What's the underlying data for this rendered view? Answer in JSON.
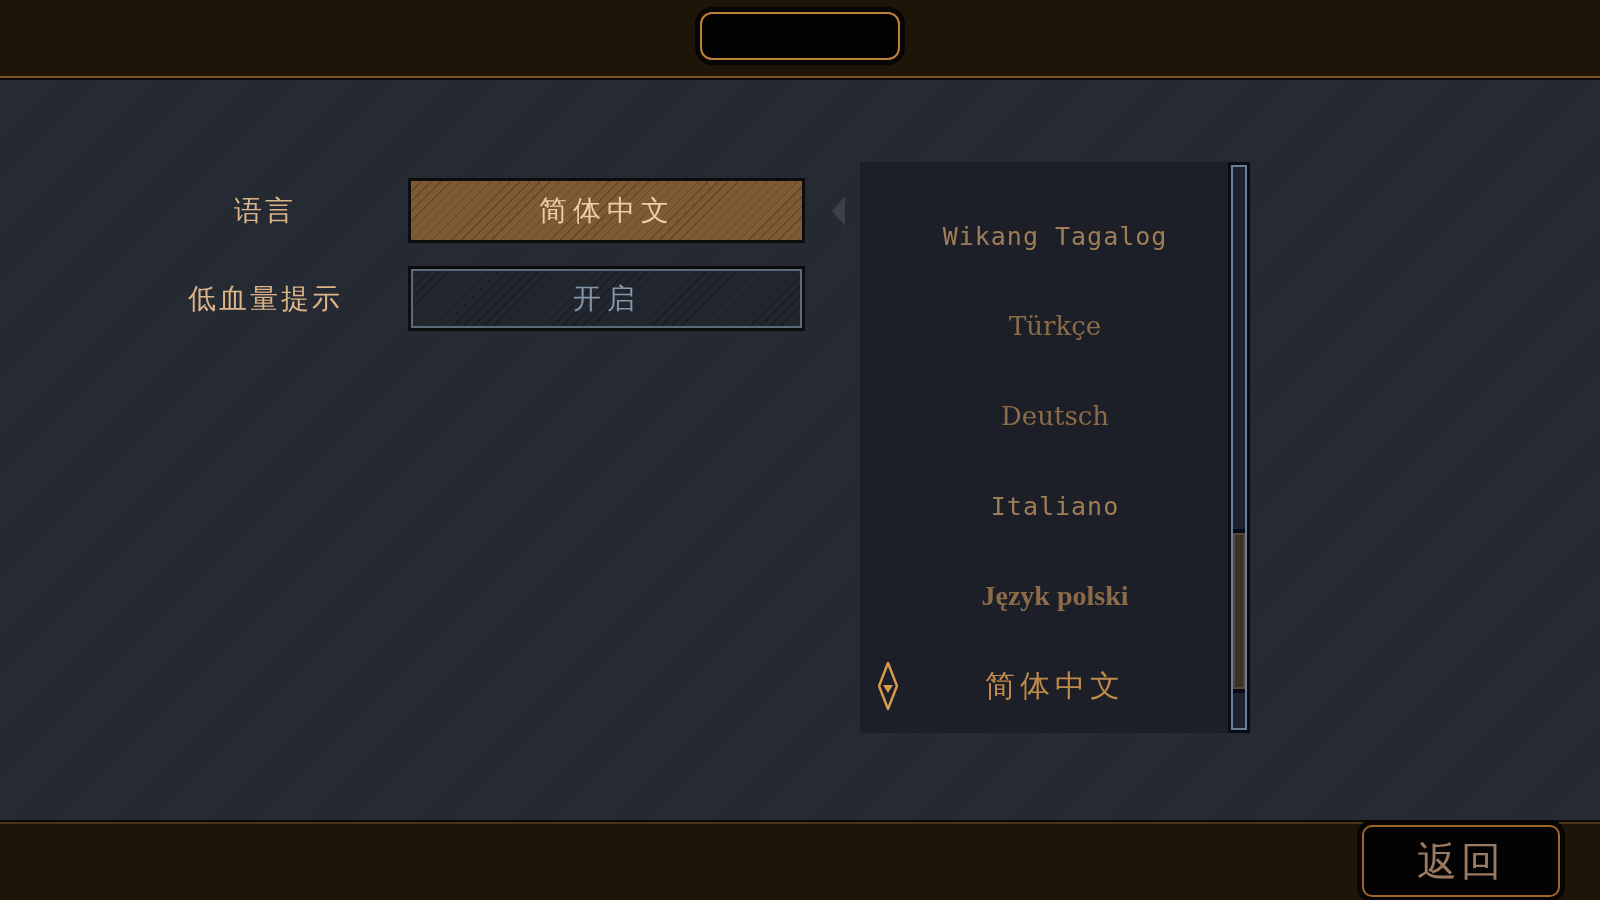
{
  "settings": [
    {
      "label": "语言",
      "value": "简体中文",
      "selected": true,
      "expanded": true
    },
    {
      "label": "低血量提示",
      "value": "开启",
      "selected": false,
      "expanded": false
    }
  ],
  "languages": [
    {
      "label": "Wikang Tagalog",
      "selected": false
    },
    {
      "label": "Türkçe",
      "selected": false
    },
    {
      "label": "Deutsch",
      "selected": false
    },
    {
      "label": "Italiano",
      "selected": false
    },
    {
      "label": "Język polski",
      "selected": false
    },
    {
      "label": "简体中文",
      "selected": true
    }
  ],
  "back_button": {
    "label": "返回"
  }
}
